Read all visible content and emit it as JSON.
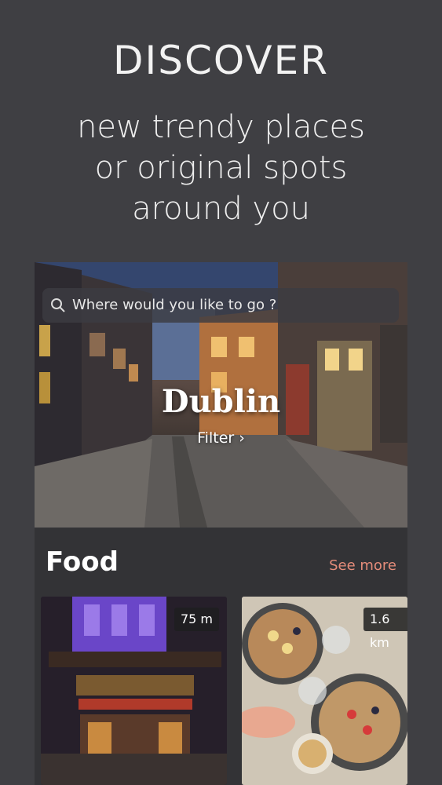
{
  "header": {
    "title": "DISCOVER",
    "subtitle_lines": [
      "new trendy places",
      "or original spots",
      "around you"
    ]
  },
  "search": {
    "placeholder": "Where would you like to go ?"
  },
  "hero": {
    "city": "Dublin",
    "filter_label": "Filter ›"
  },
  "section": {
    "title": "Food",
    "see_more": "See more"
  },
  "cards": [
    {
      "distance": "75 m"
    },
    {
      "distance": "1.6 km"
    }
  ],
  "colors": {
    "background": "#3f3f43",
    "accent": "#e58c7a",
    "panel": "#333336"
  }
}
